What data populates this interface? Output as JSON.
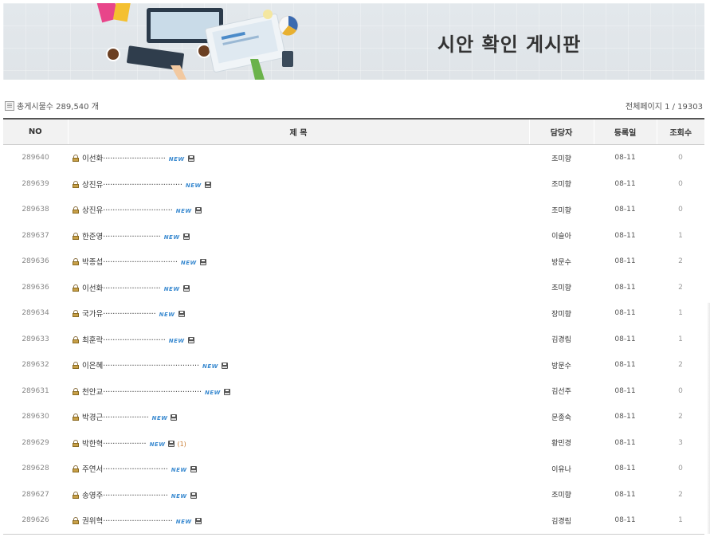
{
  "banner": {
    "title": "시안 확인 게시판"
  },
  "info": {
    "total": "총게시물수 289,540 개",
    "pages": "전체페이지 1 / 19303"
  },
  "columns": {
    "no": "NO",
    "subject": "제 목",
    "manager": "담당자",
    "date": "등록일",
    "views": "조회수"
  },
  "badge": {
    "new": "NEW"
  },
  "rows": [
    {
      "no": "289640",
      "subject": "이선화··························",
      "manager": "조미향",
      "date": "08-11",
      "views": "0",
      "comments": ""
    },
    {
      "no": "289639",
      "subject": "상진유·································",
      "manager": "조미향",
      "date": "08-11",
      "views": "0",
      "comments": ""
    },
    {
      "no": "289638",
      "subject": "상진유·····························",
      "manager": "조미향",
      "date": "08-11",
      "views": "0",
      "comments": ""
    },
    {
      "no": "289637",
      "subject": "한준영························",
      "manager": "이슬아",
      "date": "08-11",
      "views": "1",
      "comments": ""
    },
    {
      "no": "289636",
      "subject": "박종섭·······························",
      "manager": "방문수",
      "date": "08-11",
      "views": "2",
      "comments": ""
    },
    {
      "no": "289636",
      "subject": "이선화························",
      "manager": "조미향",
      "date": "08-11",
      "views": "2",
      "comments": ""
    },
    {
      "no": "289634",
      "subject": "국가유······················",
      "manager": "장미향",
      "date": "08-11",
      "views": "1",
      "comments": ""
    },
    {
      "no": "289633",
      "subject": "최훈락··························",
      "manager": "김경림",
      "date": "08-11",
      "views": "1",
      "comments": ""
    },
    {
      "no": "289632",
      "subject": "이은혜········································",
      "manager": "방문수",
      "date": "08-11",
      "views": "2",
      "comments": ""
    },
    {
      "no": "289631",
      "subject": "천안교·········································",
      "manager": "김선주",
      "date": "08-11",
      "views": "0",
      "comments": ""
    },
    {
      "no": "289630",
      "subject": "박경근···················",
      "manager": "문종숙",
      "date": "08-11",
      "views": "2",
      "comments": ""
    },
    {
      "no": "289629",
      "subject": "박한혁··················",
      "manager": "황민경",
      "date": "08-11",
      "views": "3",
      "comments": "(1)"
    },
    {
      "no": "289628",
      "subject": "주연서···························",
      "manager": "이유나",
      "date": "08-11",
      "views": "0",
      "comments": ""
    },
    {
      "no": "289627",
      "subject": "송영주···························",
      "manager": "조미향",
      "date": "08-11",
      "views": "2",
      "comments": ""
    },
    {
      "no": "289626",
      "subject": "권위혁·····························",
      "manager": "김경림",
      "date": "08-11",
      "views": "1",
      "comments": ""
    }
  ]
}
